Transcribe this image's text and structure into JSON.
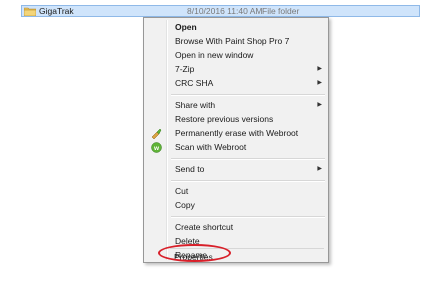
{
  "file": {
    "name": "GigaTrak",
    "date": "8/10/2016 11:40 AM",
    "type": "File folder"
  },
  "menu": {
    "open": "Open",
    "browse_psp": "Browse With Paint Shop Pro 7",
    "open_new_window": "Open in new window",
    "seven_zip": "7-Zip",
    "crc_sha": "CRC SHA",
    "share_with": "Share with",
    "restore_versions": "Restore previous versions",
    "erase_webroot": "Permanently erase with Webroot",
    "scan_webroot": "Scan with Webroot",
    "send_to": "Send to",
    "cut": "Cut",
    "copy": "Copy",
    "create_shortcut": "Create shortcut",
    "delete": "Delete",
    "rename": "Rename",
    "properties": "Properties",
    "submenu_arrow": "▶"
  },
  "icons": {
    "folder": "folder-icon",
    "erase": "webroot-erase-icon",
    "scan": "webroot-scan-icon"
  },
  "colors": {
    "selection": "#cfe4fb",
    "highlight_circle": "#d8202a",
    "webroot_green": "#5fb336"
  }
}
